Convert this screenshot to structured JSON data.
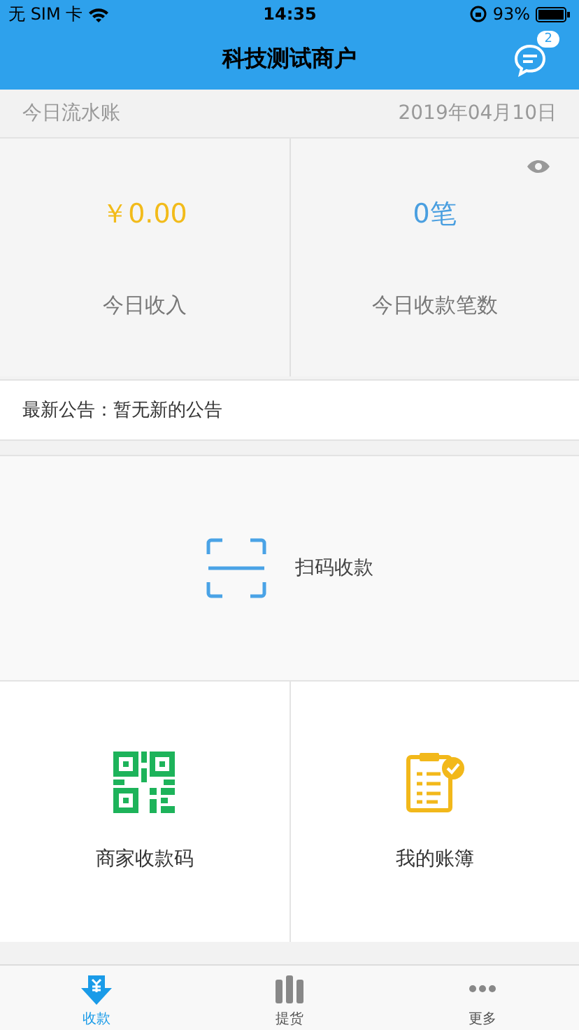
{
  "status_bar": {
    "carrier": "无 SIM 卡",
    "time": "14:35",
    "battery": "93%"
  },
  "nav": {
    "title": "科技测试商户",
    "message_badge": "2"
  },
  "ledger_header": {
    "label": "今日流水账",
    "date": "2019年04月10日"
  },
  "stats": [
    {
      "value": "￥0.00",
      "label": "今日收入",
      "color": "#f2bb1a"
    },
    {
      "value": "0笔",
      "label": "今日收款笔数",
      "color": "#4a9fe0"
    }
  ],
  "notice": {
    "label": "最新公告：",
    "text": "暂无新的公告"
  },
  "scan": {
    "label": "扫码收款"
  },
  "actions": [
    {
      "kind": "qrcode",
      "label": "商家收款码"
    },
    {
      "kind": "ledger",
      "label": "我的账簿"
    }
  ],
  "tabs": [
    {
      "kind": "collect",
      "label": "收款",
      "selected": true
    },
    {
      "kind": "pickup",
      "label": "提货",
      "selected": false
    },
    {
      "kind": "more",
      "label": "更多",
      "selected": false
    }
  ]
}
